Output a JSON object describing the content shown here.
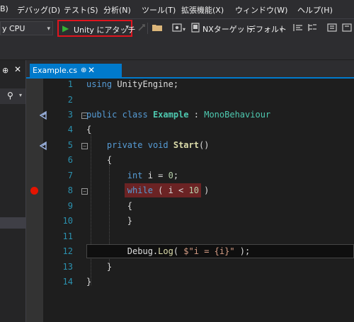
{
  "menu": [
    {
      "label": "B)"
    },
    {
      "label": "デバッグ(D)"
    },
    {
      "label": "テスト(S)"
    },
    {
      "label": "分析(N)"
    },
    {
      "label": "ツール(T)"
    },
    {
      "label": "拡張機能(X)"
    },
    {
      "label": "ウィンドウ(W)"
    },
    {
      "label": "ヘルプ(H)"
    }
  ],
  "toolbar": {
    "platform_value": "y CPU",
    "attach_label": "Unity にアタッチ",
    "nx_target_label": "NXターゲット:",
    "nx_target_value": "デフォルト"
  },
  "tab": {
    "filename": "Example.cs",
    "pin_glyph": "⊕",
    "close_glyph": "✕"
  },
  "code_lines": [
    {
      "n": "1"
    },
    {
      "n": "2"
    },
    {
      "n": "3"
    },
    {
      "n": "4"
    },
    {
      "n": "5"
    },
    {
      "n": "6"
    },
    {
      "n": "7"
    },
    {
      "n": "8"
    },
    {
      "n": "9"
    },
    {
      "n": "10"
    },
    {
      "n": "11"
    },
    {
      "n": "12"
    },
    {
      "n": "13"
    },
    {
      "n": "14"
    }
  ],
  "code": {
    "l1_kw": "using",
    "l1_ns": " UnityEngine;",
    "l3_public": "public",
    "l3_class": "class",
    "l3_name": "Example",
    "l3_colon": " : ",
    "l3_base": "MonoBehaviour",
    "l4": "{",
    "l5_private": "private",
    "l5_void": "void",
    "l5_name": "Start",
    "l5_paren": "()",
    "l6": "{",
    "l7_int": "int",
    "l7_rest": " i = ",
    "l7_num": "0",
    "l7_end": ";",
    "l8_while": "while",
    "l8_rest": " ( i < ",
    "l8_num": "10",
    "l8_end": " )",
    "l9": "{",
    "l10": "}",
    "l12_obj": "Debug",
    "l12_dot": ".",
    "l12_method": "Log",
    "l12_open": "( ",
    "l12_str": "$\"i = {i}\"",
    "l12_close": " );",
    "l13": "}",
    "l14": "}"
  },
  "colors": {
    "accent": "#007acc",
    "breakpoint": "#e51400",
    "attach_outline": "#e0141e"
  }
}
